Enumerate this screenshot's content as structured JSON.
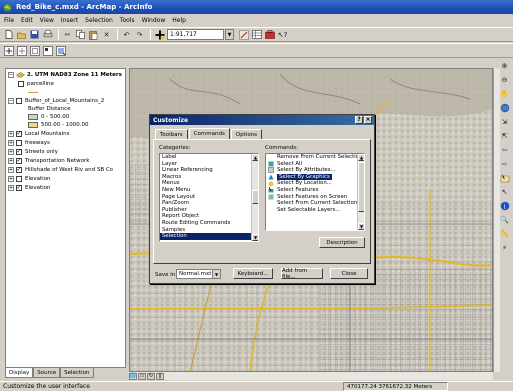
{
  "window": {
    "title": "Red_Bike_c.mxd - ArcMap - ArcInfo"
  },
  "menu": [
    "File",
    "Edit",
    "View",
    "Insert",
    "Selection",
    "Tools",
    "Window",
    "Help"
  ],
  "toolbar": {
    "scale": "1:91,717"
  },
  "toc": {
    "dataframe": "2. UTM NAD83 Zone 11 Meters",
    "layers": [
      {
        "label": "parcelline",
        "checked": false
      },
      {
        "label": "Buffer_of_Local_Mountains_2",
        "checked": false
      },
      {
        "label": "Buffer Distance",
        "checked": false
      },
      {
        "label": "0 - 500.00",
        "checked": false
      },
      {
        "label": "500.00 - 1000.00",
        "checked": false
      },
      {
        "label": "Local Mountains",
        "checked": true
      },
      {
        "label": "freeways",
        "checked": false
      },
      {
        "label": "Streets only",
        "checked": true
      },
      {
        "label": "Transportation Network",
        "checked": true
      },
      {
        "label": "Hillshade of West Riv and SB Co",
        "checked": true
      },
      {
        "label": "Elevation",
        "checked": false
      },
      {
        "label": "Elevation",
        "checked": true
      }
    ],
    "tabs": [
      "Display",
      "Source",
      "Selection"
    ]
  },
  "colors": {
    "buffer_1": "#c8dcb0",
    "buffer_2": "#f0d890",
    "titlebar": "#1d4fb8",
    "dialog_title": "#0a246a"
  },
  "dialog": {
    "title": "Customize",
    "tabs": [
      "Toolbars",
      "Commands",
      "Options"
    ],
    "categories_label": "Categories:",
    "commands_label": "Commands:",
    "categories": [
      "Label",
      "Layer",
      "Linear Referencing",
      "Macros",
      "Menus",
      "New Menu",
      "Page Layout",
      "Pan/Zoom",
      "Publisher",
      "Report Object",
      "Route Editing Commands",
      "Samples",
      "Selection"
    ],
    "selected_category": "Selection",
    "commands": [
      "Remove From Current Selection",
      "Select All",
      "Select By Attributes...",
      "Select By Graphics",
      "Select By Location...",
      "Select Features",
      "Select Features on Screen",
      "Select From Current Selection",
      "Set Selectable Layers..."
    ],
    "highlighted_command": "Select By Graphics",
    "description_button": "Description",
    "save_in_label": "Save in:",
    "save_in_value": "Normal.mxt",
    "keyboard_button": "Keyboard...",
    "add_from_file_button": "Add from file...",
    "close_button": "Close"
  },
  "status": {
    "text": "Customize the user interface",
    "coords": "470177.24  3761672.32 Meters"
  }
}
